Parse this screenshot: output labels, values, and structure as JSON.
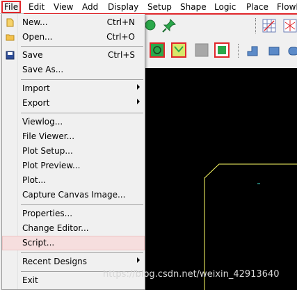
{
  "menubar": {
    "items": [
      "File",
      "Edit",
      "View",
      "Add",
      "Display",
      "Setup",
      "Shape",
      "Logic",
      "Place",
      "FlowPl"
    ]
  },
  "file_menu": {
    "new": {
      "label": "New...",
      "shortcut": "Ctrl+N"
    },
    "open": {
      "label": "Open...",
      "shortcut": "Ctrl+O"
    },
    "save": {
      "label": "Save",
      "shortcut": "Ctrl+S"
    },
    "save_as": {
      "label": "Save As..."
    },
    "import": {
      "label": "Import"
    },
    "export": {
      "label": "Export"
    },
    "viewlog": {
      "label": "Viewlog..."
    },
    "file_viewer": {
      "label": "File Viewer..."
    },
    "plot_setup": {
      "label": "Plot Setup..."
    },
    "plot_preview": {
      "label": "Plot Preview..."
    },
    "plot": {
      "label": "Plot..."
    },
    "capture": {
      "label": "Capture Canvas Image..."
    },
    "properties": {
      "label": "Properties..."
    },
    "change_editor": {
      "label": "Change Editor..."
    },
    "script": {
      "label": "Script..."
    },
    "recent_designs": {
      "label": "Recent Designs"
    },
    "exit": {
      "label": "Exit"
    }
  },
  "watermark": "https://blog.csdn.net/weixin_42913640",
  "colors": {
    "highlight": "#f6dede",
    "menubar_accent": "#e0262a",
    "canvas": "#000000",
    "board_outline": "#ffff66"
  }
}
